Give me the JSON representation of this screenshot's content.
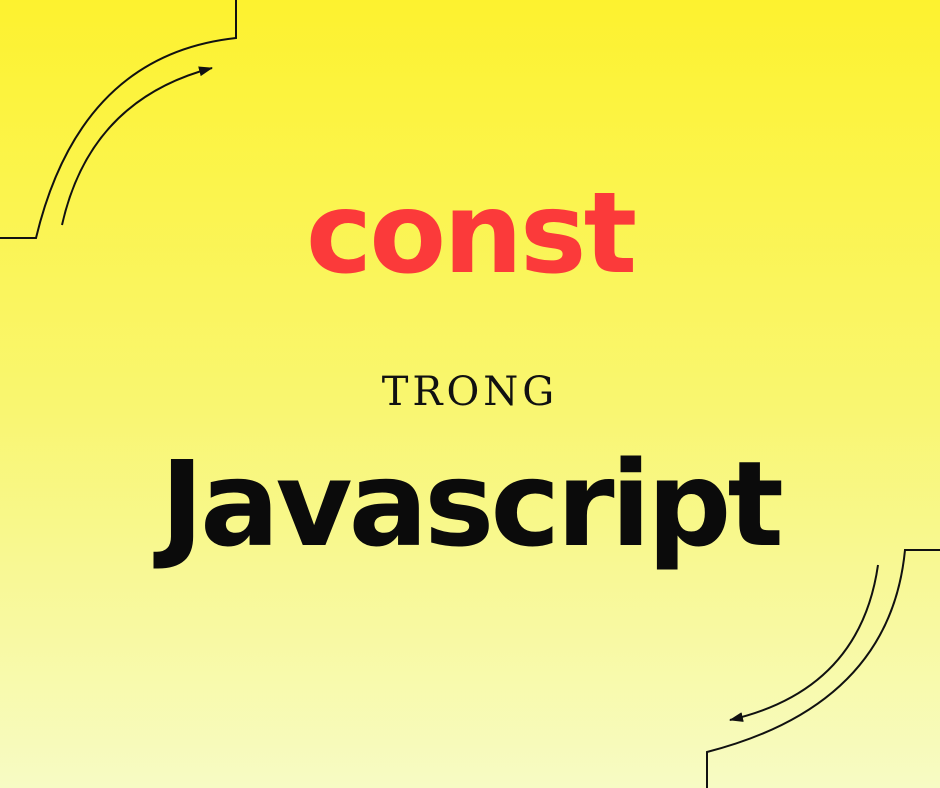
{
  "headline": {
    "keyword": "const",
    "connector": "TRONG",
    "language": "Javascript"
  },
  "colors": {
    "keyword": "#fb3a3a",
    "text": "#0b0b0b",
    "background_top": "#fdf22f",
    "background_bottom": "#f7fbc4"
  }
}
